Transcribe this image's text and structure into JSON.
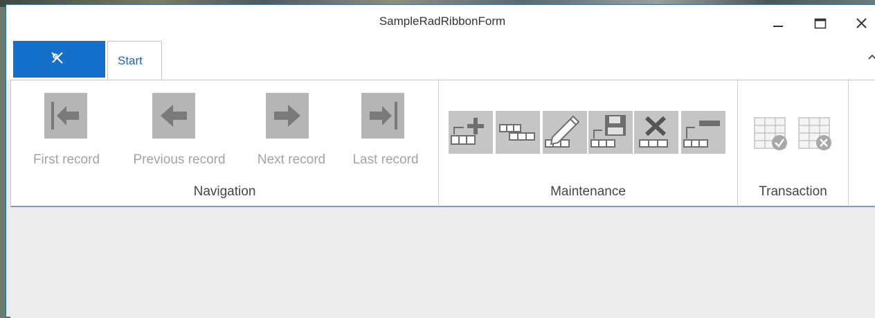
{
  "window": {
    "title": "SampleRadRibbonForm"
  },
  "tabs": {
    "app_icon": "app-menu-icon",
    "start_label": "Start"
  },
  "groups": {
    "navigation": {
      "label": "Navigation",
      "buttons": [
        {
          "label": "First record",
          "icon": "first-record-icon"
        },
        {
          "label": "Previous record",
          "icon": "previous-record-icon"
        },
        {
          "label": "Next record",
          "icon": "next-record-icon"
        },
        {
          "label": "Last record",
          "icon": "last-record-icon"
        }
      ]
    },
    "maintenance": {
      "label": "Maintenance",
      "buttons": [
        "add-record-icon",
        "insert-record-icon",
        "edit-record-icon",
        "save-record-icon",
        "delete-record-icon",
        "remove-record-icon"
      ]
    },
    "transaction": {
      "label": "Transaction",
      "buttons": [
        "commit-transaction-icon",
        "rollback-transaction-icon"
      ]
    }
  },
  "colors": {
    "accent": "#1570cc",
    "disabled_text": "#a3a3a3",
    "icon_gray": "#b5b5b5"
  }
}
